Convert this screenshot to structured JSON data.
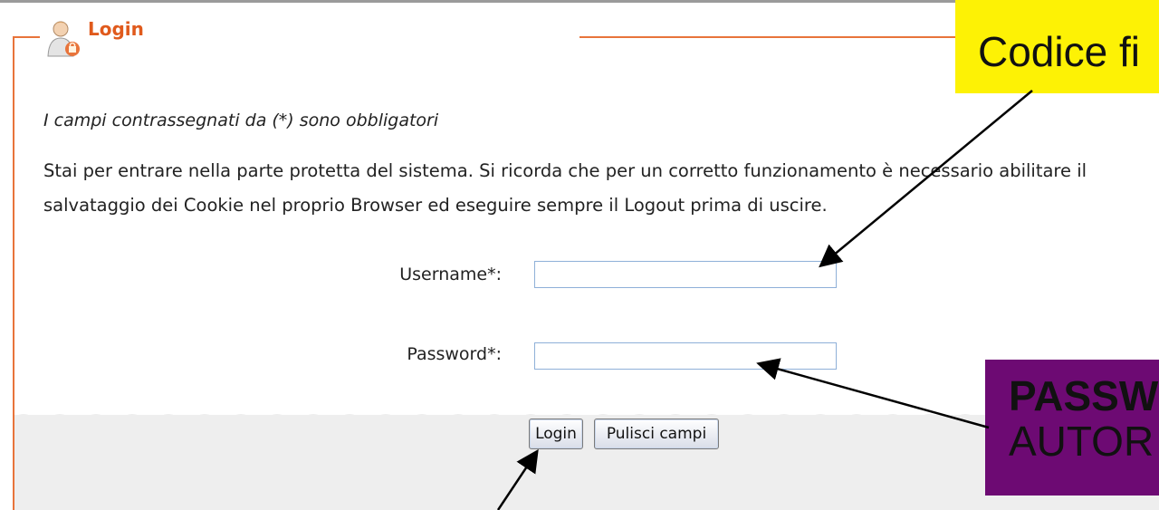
{
  "legend": {
    "title": "Login"
  },
  "required_note": "I campi contrassegnati da (*) sono obbligatori",
  "info": {
    "line1": "Stai per entrare nella parte protetta del sistema. Si ricorda che per un corretto funzionamento è necessario abilitare il",
    "line2": "salvataggio dei Cookie nel proprio Browser ed eseguire sempre il Logout prima di uscire."
  },
  "form": {
    "username_label": "Username*:",
    "password_label": "Password*:",
    "username_value": "",
    "password_value": ""
  },
  "buttons": {
    "login": "Login",
    "clear": "Pulisci campi"
  },
  "annotations": {
    "yellow_callout": "Codice fi",
    "purple_line1": "PASSW",
    "purple_line2": "AUTOR",
    "yellow_color": "#fdf205",
    "purple_color": "#6d0a73"
  },
  "colors": {
    "accent": "#e8743b",
    "title": "#e05a1c",
    "footer": "#eeeeee"
  }
}
